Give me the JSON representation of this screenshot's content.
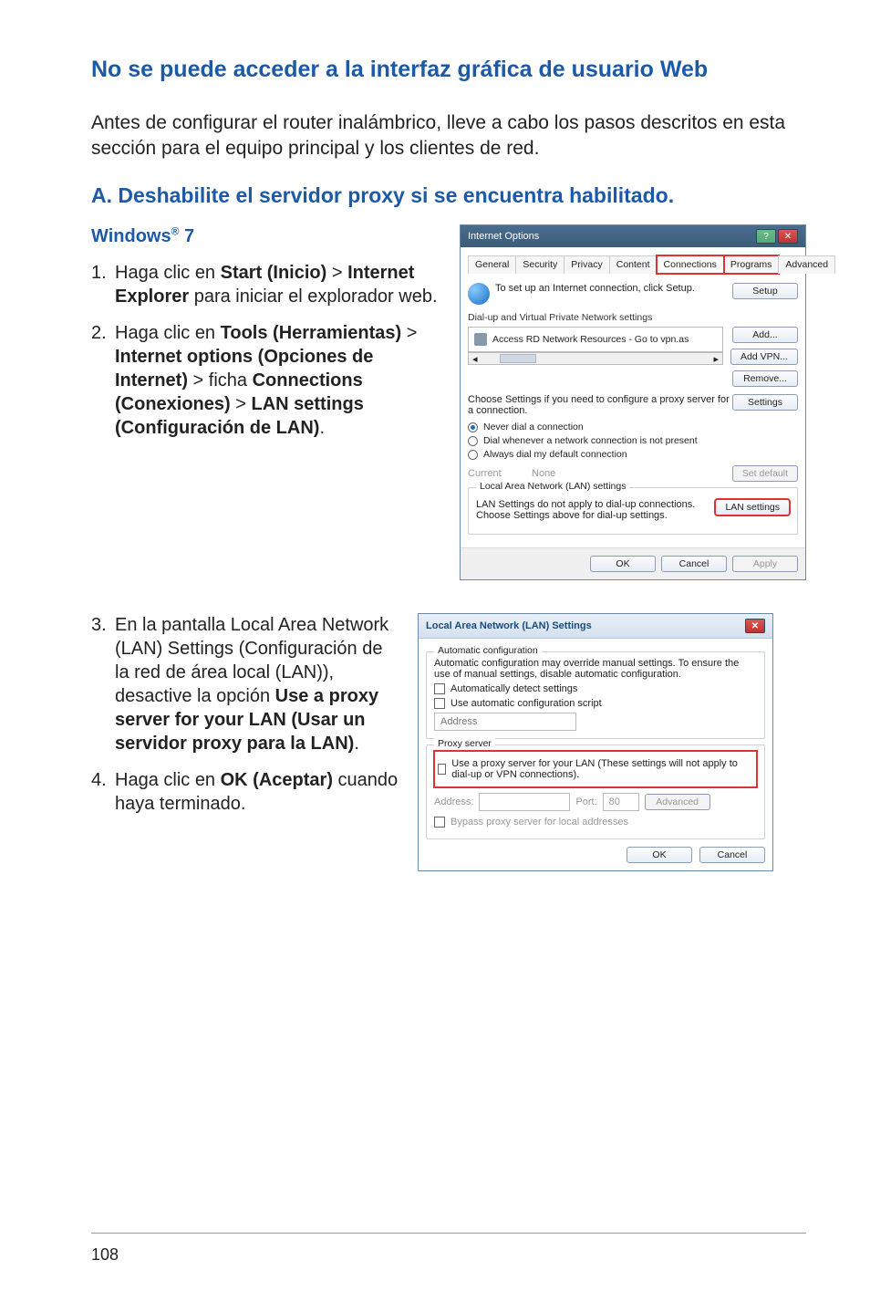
{
  "title": "No se puede acceder a la interfaz gráfica de usuario Web",
  "intro": "Antes de configurar el router inalámbrico, lleve a cabo los pasos descritos en esta sección para el equipo principal y los clientes de red.",
  "sectionA": "A.    Deshabilite el servidor proxy si se encuentra habilitado.",
  "windowsHeading": "Windows",
  "windowsSuffix": " 7",
  "step1_a": "Haga clic en ",
  "step1_b": "Start (Inicio)",
  "step1_c": " > ",
  "step1_d": "Internet Explorer",
  "step1_e": " para iniciar el explorador web.",
  "step2_a": "Haga clic en ",
  "step2_b": "Tools (Herramientas)",
  "step2_c": " > ",
  "step2_d": "Internet options (Opciones de Internet)",
  "step2_e": " > ficha ",
  "step2_f": "Connections (Conexiones)",
  "step2_g": " > ",
  "step2_h": "LAN settings (Configuración de LAN)",
  "step2_i": ".",
  "step3_a": "En la pantalla Local Area Network (LAN) Settings (Configuración de la red de área local (LAN)), desactive la opción ",
  "step3_b": "Use a proxy server for your LAN (Usar un servidor proxy para la LAN)",
  "step3_c": ".",
  "step4_a": "Haga clic en ",
  "step4_b": "OK (Aceptar)",
  "step4_c": " cuando haya terminado.",
  "pageNumber": "108",
  "io": {
    "title": "Internet Options",
    "tabs": {
      "general": "General",
      "security": "Security",
      "privacy": "Privacy",
      "content": "Content",
      "connections": "Connections",
      "programs": "Programs",
      "advanced": "Advanced"
    },
    "setupText": "To set up an Internet connection, click Setup.",
    "setupBtn": "Setup",
    "dialupLabel": "Dial-up and Virtual Private Network settings",
    "listEntry": "Access RD Network Resources - Go to vpn.as",
    "addBtn": "Add...",
    "addVpnBtn": "Add VPN...",
    "removeBtn": "Remove...",
    "chooseText": "Choose Settings if you need to configure a proxy server for a connection.",
    "settingsBtn": "Settings",
    "radioNever": "Never dial a connection",
    "radioDial": "Dial whenever a network connection is not present",
    "radioAlways": "Always dial my default connection",
    "currentLabel": "Current",
    "currentValue": "None",
    "setDefaultBtn": "Set default",
    "lanGroup": "Local Area Network (LAN) settings",
    "lanText": "LAN Settings do not apply to dial-up connections. Choose Settings above for dial-up settings.",
    "lanBtn": "LAN settings",
    "ok": "OK",
    "cancel": "Cancel",
    "apply": "Apply"
  },
  "lan": {
    "title": "Local Area Network (LAN) Settings",
    "autoGroup": "Automatic configuration",
    "autoText": "Automatic configuration may override manual settings.  To ensure the use of manual settings, disable automatic configuration.",
    "autoDetect": "Automatically detect settings",
    "autoScript": "Use automatic configuration script",
    "addressPh": "Address",
    "proxyGroup": "Proxy server",
    "proxyUse": "Use a proxy server for your LAN (These settings will not apply to dial-up or VPN connections).",
    "addrLabel": "Address:",
    "portLabel": "Port:",
    "portVal": "80",
    "advancedBtn": "Advanced",
    "bypass": "Bypass proxy server for local addresses",
    "ok": "OK",
    "cancel": "Cancel"
  }
}
